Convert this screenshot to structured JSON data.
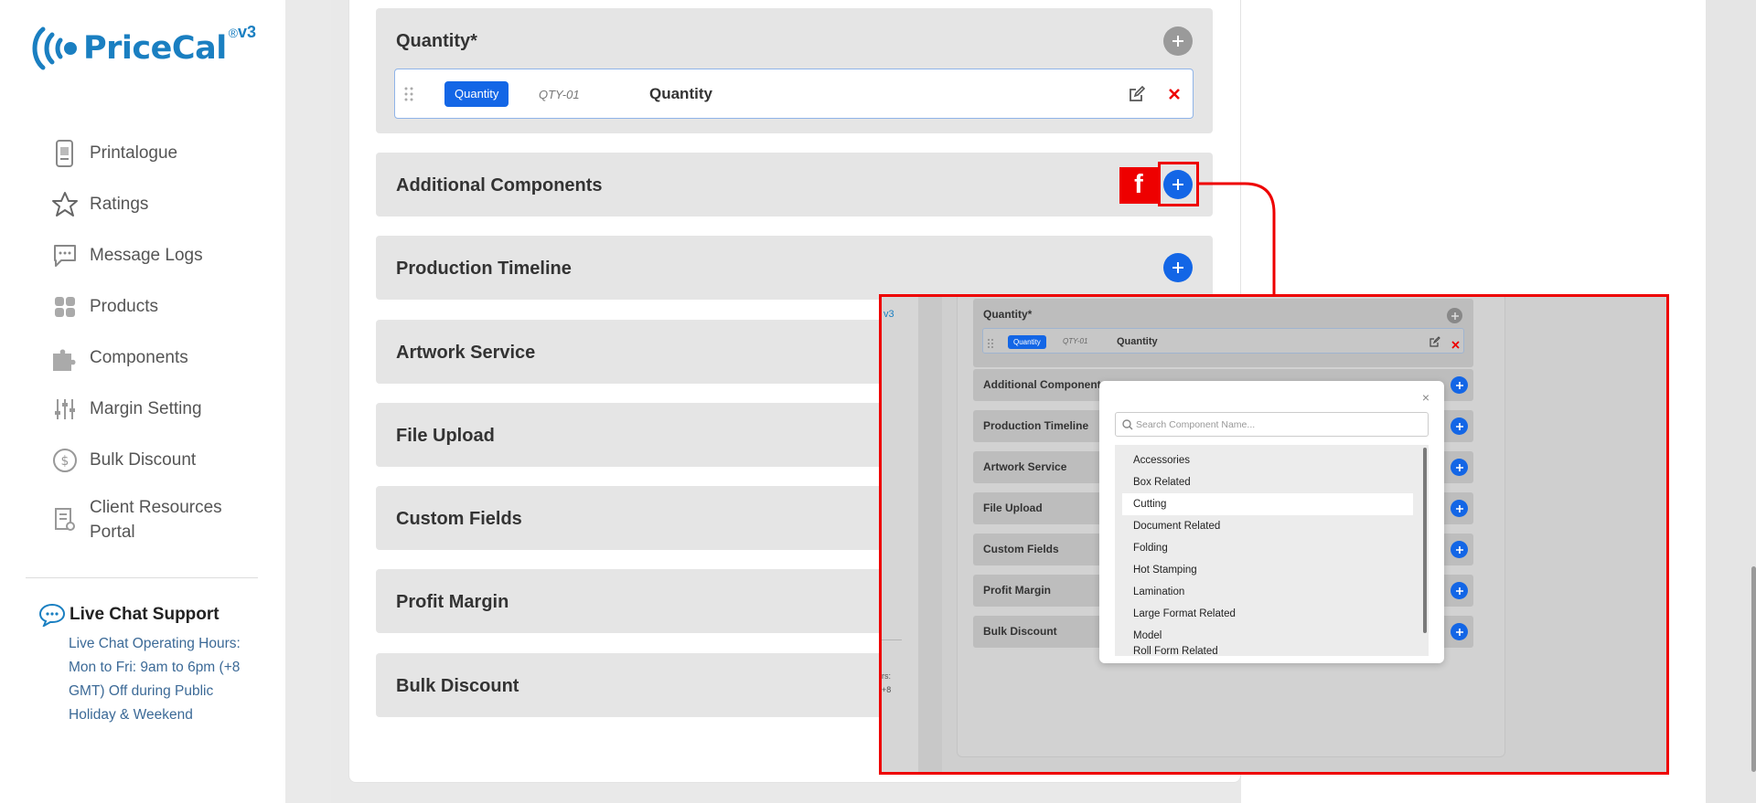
{
  "brand": {
    "name": "PriceCal",
    "reg": "®",
    "version": "v3"
  },
  "sidebar": {
    "items": [
      {
        "label": "Printalogue",
        "icon": "printalogue-icon"
      },
      {
        "label": "Ratings",
        "icon": "star-icon"
      },
      {
        "label": "Message Logs",
        "icon": "message-icon"
      },
      {
        "label": "Products",
        "icon": "products-grid-icon"
      },
      {
        "label": "Components",
        "icon": "puzzle-icon"
      },
      {
        "label": "Margin Setting",
        "icon": "sliders-icon"
      },
      {
        "label": "Bulk Discount",
        "icon": "dollar-circle-icon"
      },
      {
        "label": "Client Resources Portal",
        "icon": "resources-icon"
      }
    ],
    "chat": {
      "title": "Live Chat Support",
      "description": "Live Chat Operating Hours: Mon to Fri: 9am to 6pm (+8 GMT) Off during Public Holiday & Weekend"
    }
  },
  "main": {
    "quantity_section": {
      "title": "Quantity*",
      "row": {
        "badge": "Quantity",
        "code": "QTY-01",
        "name": "Quantity"
      }
    },
    "sections": [
      "Additional Components",
      "Production Timeline",
      "Artwork Service",
      "File Upload",
      "Custom Fields",
      "Profit Margin",
      "Bulk Discount"
    ]
  },
  "annotation": {
    "step_label": "f",
    "color": "#e00000"
  },
  "inset": {
    "version": "v3",
    "side_text_1": "rs:",
    "side_text_2": "+8",
    "quantity_section": {
      "title": "Quantity*",
      "row": {
        "badge": "Quantity",
        "code": "QTY-01",
        "name": "Quantity"
      }
    },
    "sections": [
      "Additional Components",
      "Production Timeline",
      "Artwork Service",
      "File Upload",
      "Custom Fields",
      "Profit Margin",
      "Bulk Discount"
    ],
    "modal": {
      "close": "×",
      "search_placeholder": "Search Component Name...",
      "items": [
        "Accessories",
        "Box Related",
        "Cutting",
        "Document Related",
        "Folding",
        "Hot Stamping",
        "Lamination",
        "Large Format Related",
        "Model",
        "Roll Form Related"
      ],
      "highlighted_item": "Cutting"
    }
  },
  "colors": {
    "brand": "#1a7fc1",
    "primary": "#1366e6",
    "danger": "#e00000"
  }
}
